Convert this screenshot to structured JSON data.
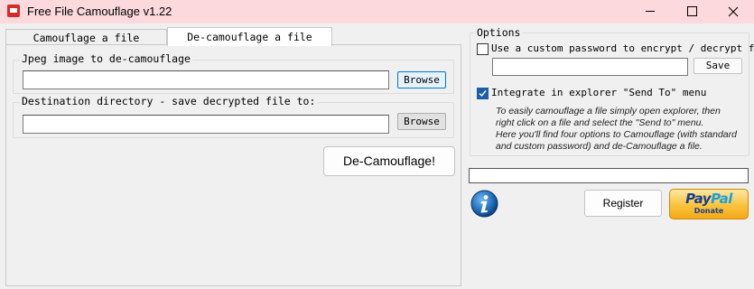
{
  "window": {
    "title": "Free File Camouflage v1.22",
    "icon": "app-icon",
    "controls": [
      "minimize-icon",
      "maximize-icon",
      "close-icon"
    ]
  },
  "tabs": [
    {
      "label": "Camouflage a file",
      "active": false
    },
    {
      "label": "De-camouflage a file",
      "active": true
    }
  ],
  "decamouflage": {
    "jpeg_group_label": "Jpeg image to de-camouflage",
    "jpeg_value": "",
    "dest_group_label": "Destination directory - save decrypted file to:",
    "dest_value": "",
    "browse_label": "Browse",
    "action_label": "De-Camouflage!"
  },
  "options": {
    "label": "Options",
    "custom_password_label": "Use a custom password to encrypt / decrypt file",
    "custom_password_checked": false,
    "password_value": "",
    "save_label": "Save",
    "send_to_label": "Integrate in explorer \"Send To\" menu",
    "send_to_checked": true,
    "info_lines": [
      "To easily camouflage a file simply open explorer, then",
      "right click on a file and select the \"Send to\" menu.",
      "Here you'll find four options to Camouflage (with standard",
      "and custom password) and de-Camouflage a file."
    ]
  },
  "progress": {
    "value": 0
  },
  "footer": {
    "register_label": "Register",
    "info_icon": "info-icon",
    "paypal": {
      "logo_pay": "Pay",
      "logo_pal": "Pal",
      "donate": "Donate"
    }
  },
  "colors": {
    "titlebar": "#fbd9dd",
    "accent": "#0078d7",
    "checkbox_checked": "#1c5ea8"
  }
}
